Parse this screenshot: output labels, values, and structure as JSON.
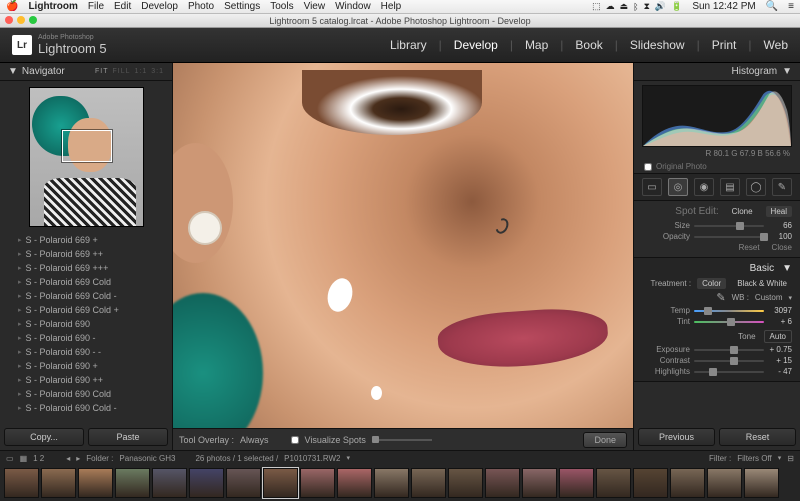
{
  "mac": {
    "app": "Lightroom",
    "menu": [
      "File",
      "Edit",
      "Develop",
      "Photo",
      "Settings",
      "Tools",
      "View",
      "Window",
      "Help"
    ],
    "clock": "Sun 12:42 PM"
  },
  "window": {
    "title": "Lightroom 5 catalog.lrcat - Adobe Photoshop Lightroom - Develop"
  },
  "brand": {
    "small": "Adobe Photoshop",
    "name": "Lightroom 5",
    "mark": "Lr"
  },
  "modules": [
    "Library",
    "Develop",
    "Map",
    "Book",
    "Slideshow",
    "Print",
    "Web"
  ],
  "active_module": "Develop",
  "navigator": {
    "title": "Navigator",
    "modes": [
      "FIT",
      "FILL",
      "1:1",
      "3:1"
    ],
    "active_mode": "FIT"
  },
  "presets": [
    "S - Polaroid 669 +",
    "S - Polaroid 669 ++",
    "S - Polaroid 669 +++",
    "S - Polaroid 669 Cold",
    "S - Polaroid 669 Cold -",
    "S - Polaroid 669 Cold +",
    "S - Polaroid 690",
    "S - Polaroid 690 -",
    "S - Polaroid 690 - -",
    "S - Polaroid 690 +",
    "S - Polaroid 690 ++",
    "S - Polaroid 690 Cold",
    "S - Polaroid 690 Cold -"
  ],
  "left_buttons": {
    "copy": "Copy...",
    "paste": "Paste"
  },
  "toolbar": {
    "overlay_label": "Tool Overlay :",
    "overlay_value": "Always",
    "visualize": "Visualize Spots",
    "done": "Done"
  },
  "histogram": {
    "title": "Histogram",
    "readout": "R 80.1  G 67.9  B 56.6 %",
    "original": "Original Photo"
  },
  "spot": {
    "title": "Spot Edit:",
    "clone": "Clone",
    "heal": "Heal",
    "size_label": "Size",
    "size_value": "66",
    "opacity_label": "Opacity",
    "opacity_value": "100",
    "reset": "Reset",
    "close": "Close"
  },
  "basic": {
    "title": "Basic",
    "treatment": "Treatment :",
    "color": "Color",
    "bw": "Black & White",
    "wb_label": "WB :",
    "wb_value": "Custom",
    "temp_label": "Temp",
    "temp_value": "3097",
    "tint_label": "Tint",
    "tint_value": "+ 6",
    "tone": "Tone",
    "auto": "Auto",
    "exposure_label": "Exposure",
    "exposure_value": "+ 0.75",
    "contrast_label": "Contrast",
    "contrast_value": "+ 15",
    "highlights_label": "Highlights",
    "highlights_value": "- 47"
  },
  "right_buttons": {
    "previous": "Previous",
    "reset": "Reset"
  },
  "footer": {
    "pages": "1   2",
    "folder_label": "Folder :",
    "folder": "Panasonic GH3",
    "count": "26 photos / 1 selected /",
    "filename": "P1010731.RW2",
    "filter_label": "Filter :",
    "filter_value": "Filters Off"
  }
}
